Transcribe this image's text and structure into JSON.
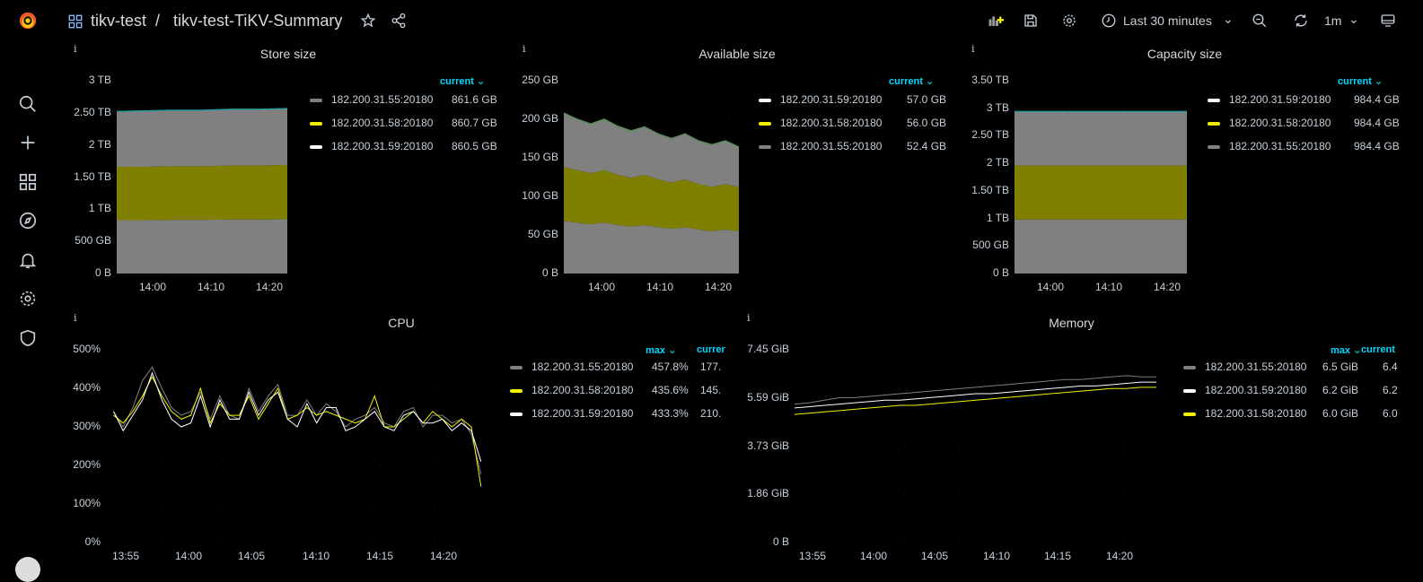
{
  "header": {
    "folder": "tikv-test",
    "separator": "/",
    "dashboard": "tikv-test-TiKV-Summary",
    "time_range": "Last 30 minutes",
    "refresh": "1m"
  },
  "icons": [
    "grafana-logo",
    "search-icon",
    "plus-icon",
    "dashboards-icon",
    "explore-icon",
    "alert-bell-icon",
    "gear-icon",
    "shield-icon",
    "avatar",
    "star-icon",
    "share-icon",
    "add-panel-icon",
    "save-icon",
    "settings-icon",
    "clock-icon",
    "zoom-out-icon",
    "refresh-icon",
    "tv-mode-icon"
  ],
  "colors": {
    "gray": "#808080",
    "yellow": "#f2f200",
    "white": "#ffffff",
    "olive": "#808000",
    "legend_head": "#00d8ff"
  },
  "panels": [
    {
      "id": "store",
      "title": "Store size",
      "info": "i",
      "legend_head": "current",
      "yticks": [
        "0 B",
        "500 GB",
        "1 TB",
        "1.50 TB",
        "2 TB",
        "2.50 TB",
        "3 TB"
      ],
      "xticks": [
        "14:00",
        "14:10",
        "14:20"
      ],
      "legend": [
        {
          "name": "182.200.31.55:20180",
          "value": "861.6 GB",
          "color": "gray"
        },
        {
          "name": "182.200.31.58:20180",
          "value": "860.7 GB",
          "color": "yellow"
        },
        {
          "name": "182.200.31.59:20180",
          "value": "860.5 GB",
          "color": "white"
        }
      ]
    },
    {
      "id": "avail",
      "title": "Available size",
      "info": "i",
      "legend_head": "current",
      "yticks": [
        "0 B",
        "50 GB",
        "100 GB",
        "150 GB",
        "200 GB",
        "250 GB"
      ],
      "xticks": [
        "14:00",
        "14:10",
        "14:20"
      ],
      "legend": [
        {
          "name": "182.200.31.59:20180",
          "value": "57.0 GB",
          "color": "white"
        },
        {
          "name": "182.200.31.58:20180",
          "value": "56.0 GB",
          "color": "yellow"
        },
        {
          "name": "182.200.31.55:20180",
          "value": "52.4 GB",
          "color": "gray"
        }
      ]
    },
    {
      "id": "cap",
      "title": "Capacity size",
      "info": "i",
      "legend_head": "current",
      "yticks": [
        "0 B",
        "500 GB",
        "1 TB",
        "1.50 TB",
        "2 TB",
        "2.50 TB",
        "3 TB",
        "3.50 TB"
      ],
      "xticks": [
        "14:00",
        "14:10",
        "14:20"
      ],
      "legend": [
        {
          "name": "182.200.31.59:20180",
          "value": "984.4 GB",
          "color": "white"
        },
        {
          "name": "182.200.31.58:20180",
          "value": "984.4 GB",
          "color": "yellow"
        },
        {
          "name": "182.200.31.55:20180",
          "value": "984.4 GB",
          "color": "gray"
        }
      ]
    },
    {
      "id": "cpu",
      "title": "CPU",
      "info": "i",
      "legend_head": "max",
      "legend_head2": "current",
      "yticks": [
        "0%",
        "100%",
        "200%",
        "300%",
        "400%",
        "500%"
      ],
      "xticks": [
        "13:55",
        "14:00",
        "14:05",
        "14:10",
        "14:15",
        "14:20"
      ],
      "legend": [
        {
          "name": "182.200.31.55:20180",
          "value": "457.8%",
          "value2": "177.",
          "color": "gray"
        },
        {
          "name": "182.200.31.58:20180",
          "value": "435.6%",
          "value2": "145.",
          "color": "yellow"
        },
        {
          "name": "182.200.31.59:20180",
          "value": "433.3%",
          "value2": "210.",
          "color": "white"
        }
      ]
    },
    {
      "id": "mem",
      "title": "Memory",
      "info": "i",
      "legend_head": "max",
      "legend_head2": "current",
      "yticks": [
        "0 B",
        "1.86 GiB",
        "3.73 GiB",
        "5.59 GiB",
        "7.45 GiB"
      ],
      "xticks": [
        "13:55",
        "14:00",
        "14:05",
        "14:10",
        "14:15",
        "14:20"
      ],
      "legend": [
        {
          "name": "182.200.31.55:20180",
          "value": "6.5 GiB",
          "value2": "6.4",
          "color": "gray"
        },
        {
          "name": "182.200.31.59:20180",
          "value": "6.2 GiB",
          "value2": "6.2",
          "color": "white"
        },
        {
          "name": "182.200.31.58:20180",
          "value": "6.0 GiB",
          "value2": "6.0",
          "color": "yellow"
        }
      ]
    }
  ],
  "chart_data": [
    {
      "panel": "store",
      "type": "area",
      "stacked": true,
      "unit": "TB",
      "ylim": [
        0,
        3
      ],
      "xlim_minutes_after_13h": [
        53.8,
        83
      ],
      "series": [
        {
          "name": "182.200.31.59:20180",
          "color": "gray",
          "values": [
            0.83,
            0.83,
            0.835,
            0.835,
            0.84,
            0.84,
            0.845
          ]
        },
        {
          "name": "182.200.31.58:20180",
          "color": "olive",
          "values": [
            0.83,
            0.83,
            0.835,
            0.835,
            0.84,
            0.84,
            0.845
          ]
        },
        {
          "name": "182.200.31.55:20180",
          "color": "gray",
          "values": [
            0.86,
            0.87,
            0.87,
            0.87,
            0.875,
            0.875,
            0.875
          ]
        }
      ]
    },
    {
      "panel": "avail",
      "type": "area",
      "stacked": true,
      "unit": "GB",
      "ylim": [
        0,
        250
      ],
      "xlim_minutes_after_13h": [
        53.8,
        83
      ],
      "series": [
        {
          "name": "182.200.31.55:20180",
          "color": "gray",
          "values": [
            68,
            66,
            64,
            66,
            63,
            61,
            63,
            60,
            58,
            60,
            57,
            55,
            57,
            55
          ]
        },
        {
          "name": "182.200.31.58:20180",
          "color": "olive",
          "values": [
            70,
            68,
            66,
            68,
            65,
            63,
            65,
            62,
            60,
            62,
            59,
            57,
            59,
            57
          ]
        },
        {
          "name": "182.200.31.59:20180",
          "color": "gray",
          "values": [
            70,
            66,
            64,
            66,
            63,
            61,
            62,
            59,
            57,
            59,
            56,
            55,
            56,
            52
          ]
        }
      ]
    },
    {
      "panel": "cap",
      "type": "area",
      "stacked": true,
      "unit": "TB",
      "ylim": [
        0,
        3.5
      ],
      "xlim_minutes_after_13h": [
        53.8,
        83
      ],
      "series": [
        {
          "name": "182.200.31.55:20180",
          "color": "gray",
          "values": [
            0.98,
            0.98
          ]
        },
        {
          "name": "182.200.31.58:20180",
          "color": "olive",
          "values": [
            0.98,
            0.98
          ]
        },
        {
          "name": "182.200.31.59:20180",
          "color": "gray",
          "values": [
            0.98,
            0.98
          ]
        }
      ]
    },
    {
      "panel": "cpu",
      "type": "line",
      "unit": "%",
      "ylim": [
        0,
        500
      ],
      "xlim_minutes_after_13h": [
        53.4,
        83.5
      ],
      "x_range": [
        54,
        83.2
      ],
      "series": [
        {
          "name": "182.200.31.55:20180",
          "color": "gray",
          "values": [
            340,
            300,
            350,
            420,
            455,
            400,
            350,
            330,
            340,
            390,
            320,
            380,
            330,
            320,
            400,
            340,
            380,
            410,
            330,
            330,
            370,
            330,
            360,
            340,
            300,
            320,
            330,
            350,
            310,
            300,
            340,
            350,
            300,
            330,
            330,
            310,
            320,
            280,
            177
          ]
        },
        {
          "name": "182.200.31.58:20180",
          "color": "yellow",
          "values": [
            330,
            310,
            340,
            380,
            430,
            380,
            340,
            320,
            330,
            400,
            310,
            360,
            330,
            330,
            380,
            320,
            360,
            400,
            320,
            330,
            350,
            330,
            340,
            330,
            320,
            310,
            320,
            380,
            300,
            300,
            320,
            340,
            310,
            340,
            320,
            300,
            320,
            300,
            145
          ]
        },
        {
          "name": "182.200.31.59:20180",
          "color": "white",
          "values": [
            340,
            290,
            330,
            370,
            440,
            370,
            320,
            300,
            310,
            380,
            300,
            370,
            320,
            320,
            390,
            330,
            370,
            390,
            320,
            300,
            360,
            310,
            350,
            350,
            290,
            300,
            320,
            340,
            300,
            290,
            330,
            340,
            310,
            310,
            320,
            290,
            310,
            290,
            210
          ]
        }
      ]
    },
    {
      "panel": "mem",
      "type": "line",
      "unit": "GiB",
      "ylim": [
        0,
        7.45
      ],
      "xlim_minutes_after_13h": [
        53.5,
        83
      ],
      "x_range": [
        53.5,
        82.5
      ],
      "series": [
        {
          "name": "182.200.31.55:20180",
          "color": "gray",
          "values": [
            5.35,
            5.4,
            5.5,
            5.6,
            5.6,
            5.65,
            5.7,
            5.75,
            5.8,
            5.85,
            5.9,
            5.95,
            6.0,
            6.05,
            6.1,
            6.15,
            6.2,
            6.25,
            6.3,
            6.3,
            6.35,
            6.4,
            6.45,
            6.4,
            6.4
          ]
        },
        {
          "name": "182.200.31.59:20180",
          "color": "white",
          "values": [
            5.2,
            5.25,
            5.3,
            5.35,
            5.4,
            5.45,
            5.5,
            5.5,
            5.55,
            5.6,
            5.65,
            5.7,
            5.75,
            5.75,
            5.8,
            5.85,
            5.9,
            5.95,
            6.0,
            6.05,
            6.05,
            6.1,
            6.15,
            6.2,
            6.2
          ]
        },
        {
          "name": "182.200.31.58:20180",
          "color": "yellow",
          "values": [
            4.95,
            5.0,
            5.05,
            5.1,
            5.15,
            5.2,
            5.25,
            5.3,
            5.3,
            5.35,
            5.4,
            5.45,
            5.5,
            5.55,
            5.6,
            5.65,
            5.7,
            5.75,
            5.8,
            5.85,
            5.9,
            5.95,
            5.95,
            6.0,
            6.0
          ]
        }
      ]
    }
  ]
}
